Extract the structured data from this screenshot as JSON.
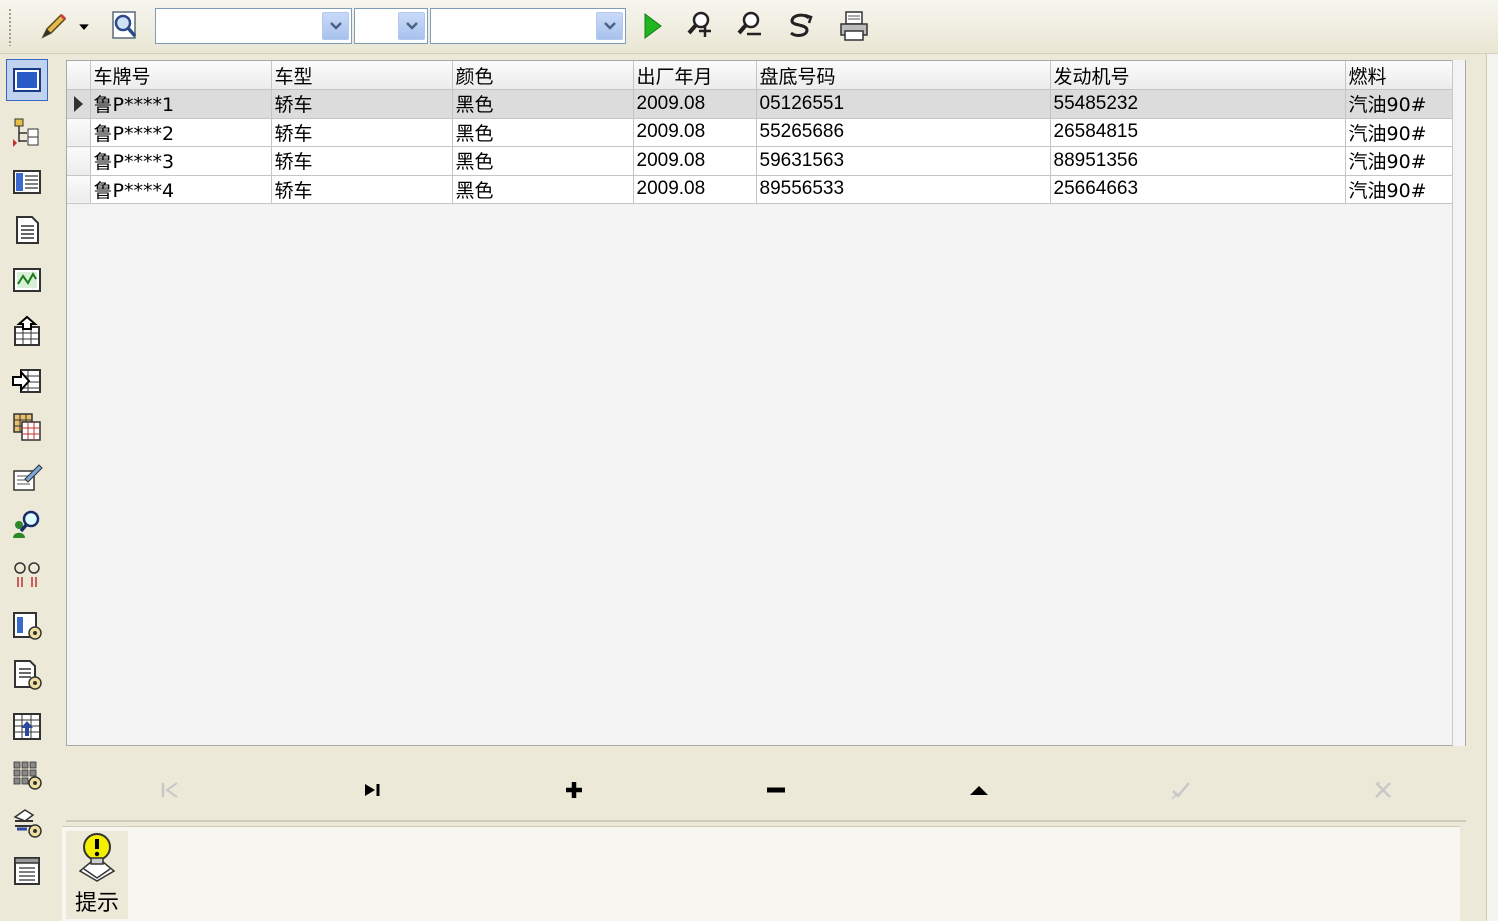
{
  "toolbar": {
    "icons": [
      "pencil-icon",
      "dropdown-arrow-icon",
      "search-document-icon",
      "run-query-icon",
      "find-icon",
      "find-next-icon",
      "refresh-icon",
      "print-icon"
    ],
    "combo1": {
      "value": "",
      "placeholder": ""
    },
    "combo2": {
      "value": "",
      "placeholder": ""
    },
    "combo3": {
      "value": "",
      "placeholder": ""
    },
    "colors": {
      "play": "#22b522",
      "combo_border": "#7f9db9"
    }
  },
  "sidebar": {
    "items": [
      {
        "icon": "form-view-icon",
        "active": true
      },
      {
        "icon": "tree-structure-icon"
      },
      {
        "icon": "list-view-icon"
      },
      {
        "icon": "document-icon"
      },
      {
        "icon": "chart-icon"
      },
      {
        "icon": "import-icon"
      },
      {
        "icon": "export-icon"
      },
      {
        "icon": "copy-table-icon"
      },
      {
        "icon": "edit-record-icon"
      },
      {
        "icon": "user-search-icon"
      },
      {
        "icon": "filter-icon"
      },
      {
        "icon": "report-settings-icon"
      },
      {
        "icon": "document-settings-icon"
      },
      {
        "icon": "table-upload-icon"
      },
      {
        "icon": "grid-settings-icon"
      },
      {
        "icon": "user-settings-icon"
      },
      {
        "icon": "notes-icon"
      }
    ]
  },
  "grid": {
    "columns": [
      "车牌号",
      "车型",
      "颜色",
      "出厂年月",
      "盘底号码",
      "发动机号",
      "燃料"
    ],
    "rows": [
      {
        "plate": "鲁P****1",
        "type": "轿车",
        "color": "黑色",
        "date": "2009.08",
        "chassis": "05126551",
        "engine": "55485232",
        "fuel": "汽油90#"
      },
      {
        "plate": "鲁P****2",
        "type": "轿车",
        "color": "黑色",
        "date": "2009.08",
        "chassis": "55265686",
        "engine": "26584815",
        "fuel": "汽油90#"
      },
      {
        "plate": "鲁P****3",
        "type": "轿车",
        "color": "黑色",
        "date": "2009.08",
        "chassis": "59631563",
        "engine": "88951356",
        "fuel": "汽油90#"
      },
      {
        "plate": "鲁P****4",
        "type": "轿车",
        "color": "黑色",
        "date": "2009.08",
        "chassis": "89556533",
        "engine": "25664663",
        "fuel": "汽油90#"
      }
    ],
    "selected_row": 0
  },
  "navigator": {
    "buttons": [
      "first-record-icon",
      "last-record-icon",
      "add-record-icon",
      "delete-record-icon",
      "edit-record-icon",
      "post-record-icon",
      "cancel-record-icon"
    ]
  },
  "hint": {
    "label": "提示"
  }
}
